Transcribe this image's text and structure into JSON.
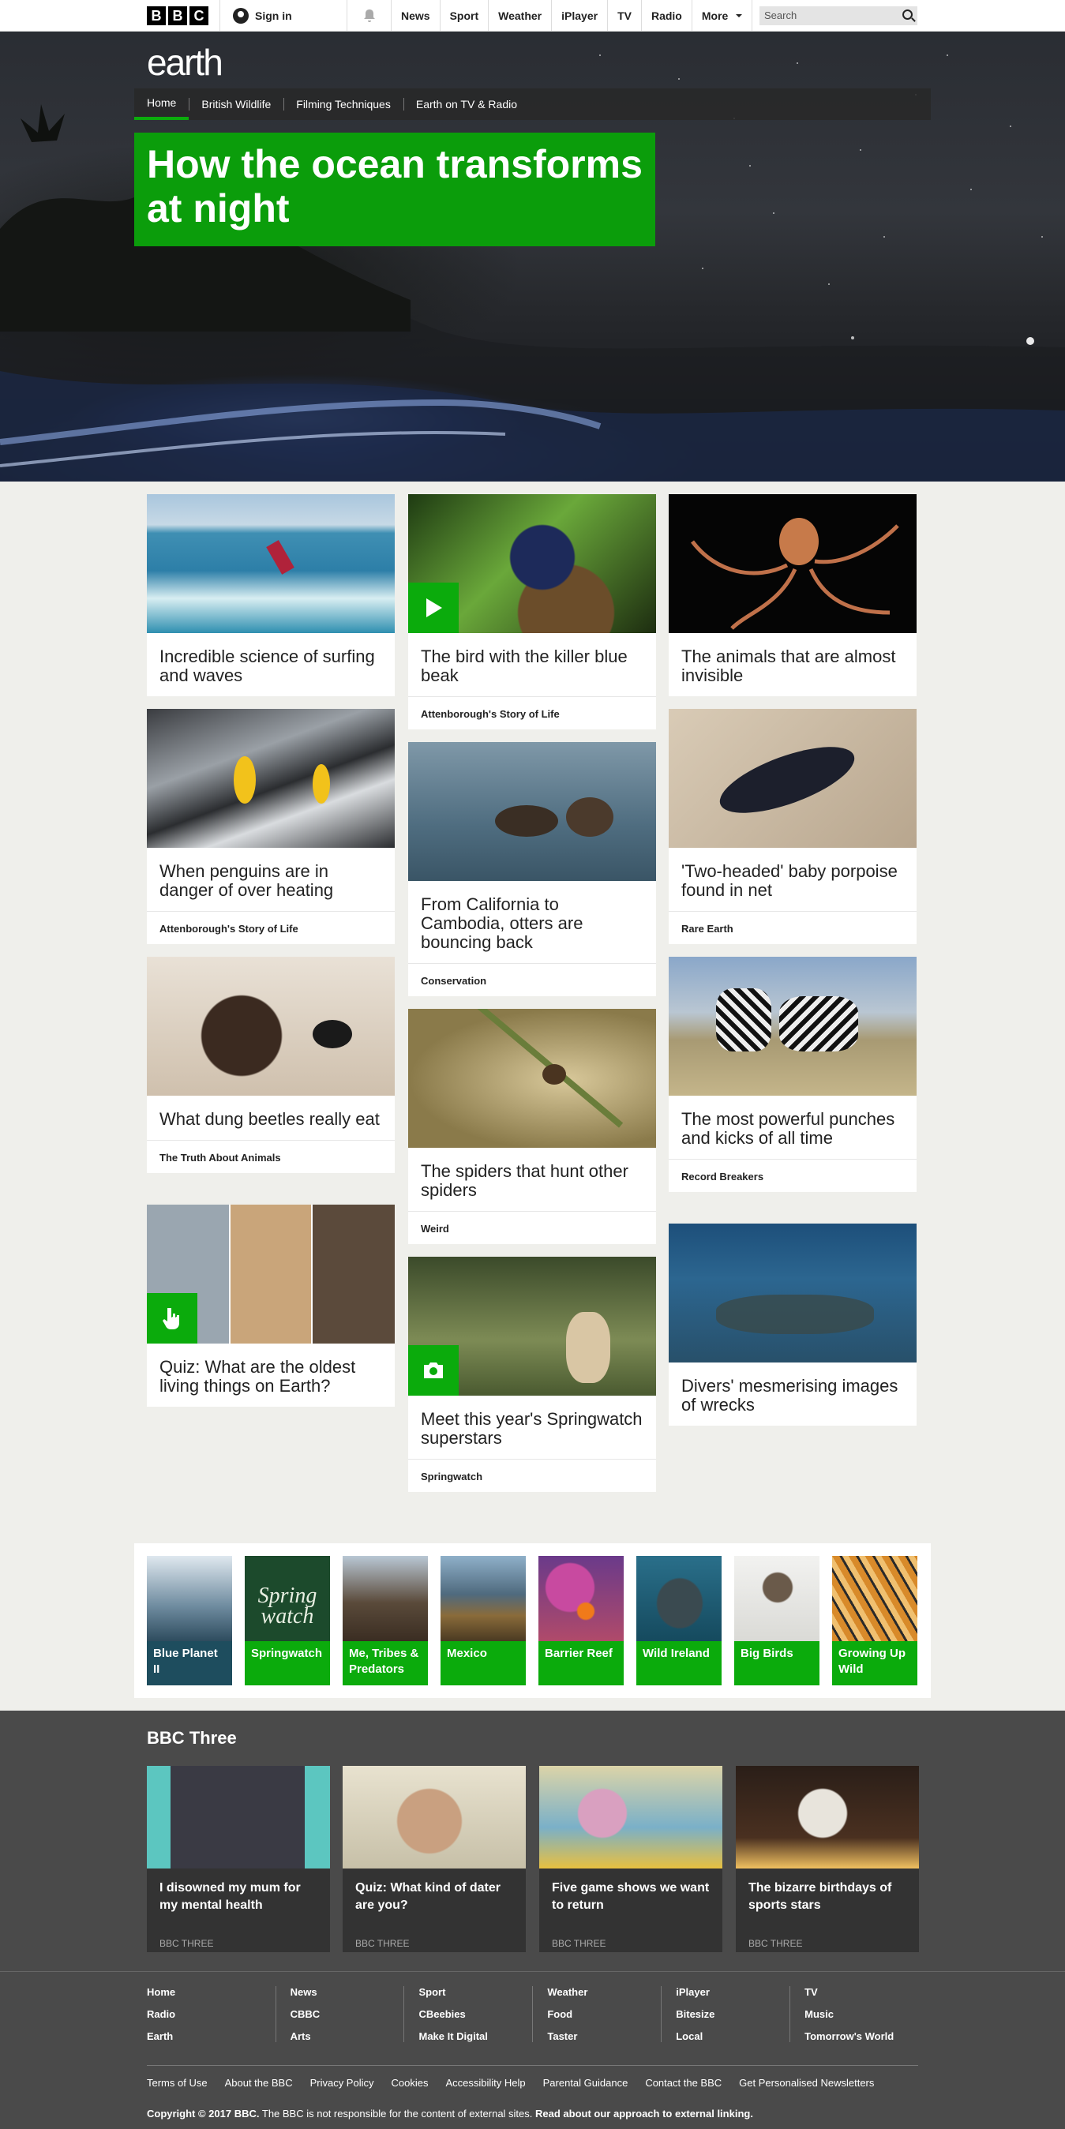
{
  "topbar": {
    "logo": [
      "B",
      "B",
      "C"
    ],
    "signin": "Sign in",
    "nav": [
      "News",
      "Sport",
      "Weather",
      "iPlayer",
      "TV",
      "Radio",
      "More"
    ],
    "search_placeholder": "Search"
  },
  "hero": {
    "brand": "earth",
    "subnav": [
      "Home",
      "British Wildlife",
      "Filming Techniques",
      "Earth on TV & Radio"
    ],
    "headline": "How the ocean transforms at night"
  },
  "cards": [
    {
      "title": "Incredible science of surfing and waves",
      "tag": ""
    },
    {
      "title": "The bird with the killer blue beak",
      "tag": "Attenborough's Story of Life"
    },
    {
      "title": "The animals that are almost invisible",
      "tag": ""
    },
    {
      "title": "When penguins are in danger of over heating",
      "tag": "Attenborough's Story of Life"
    },
    {
      "title": "From California to Cambodia, otters are bouncing back",
      "tag": "Conservation"
    },
    {
      "title": "'Two-headed' baby porpoise found in net",
      "tag": "Rare Earth"
    },
    {
      "title": "What dung beetles really eat",
      "tag": "The Truth About Animals"
    },
    {
      "title": "The spiders that hunt other spiders",
      "tag": "Weird"
    },
    {
      "title": "The most powerful punches and kicks of all time",
      "tag": "Record Breakers"
    },
    {
      "title": "Quiz: What are the oldest living things on Earth?",
      "tag": ""
    },
    {
      "title": "Meet this year's Springwatch superstars",
      "tag": "Springwatch"
    },
    {
      "title": "Divers' mesmerising images of wrecks",
      "tag": ""
    }
  ],
  "strip": [
    "Blue Planet II",
    "Springwatch",
    "Me, Tribes & Predators",
    "Mexico",
    "Barrier Reef",
    "Wild Ireland",
    "Big Birds",
    "Growing Up Wild"
  ],
  "springwatch_logo": "Spring watch",
  "three": {
    "heading": "BBC Three",
    "source": "BBC THREE",
    "items": [
      "I disowned my mum for my mental health",
      "Quiz: What kind of dater are you?",
      "Five game shows we want to return",
      "The bizarre birthdays of sports stars"
    ]
  },
  "footer": {
    "columns": [
      [
        "Home",
        "Radio",
        "Earth"
      ],
      [
        "News",
        "CBBC",
        "Arts"
      ],
      [
        "Sport",
        "CBeebies",
        "Make It Digital"
      ],
      [
        "Weather",
        "Food",
        "Taster"
      ],
      [
        "iPlayer",
        "Bitesize",
        "Local"
      ],
      [
        "TV",
        "Music",
        "Tomorrow's World"
      ]
    ],
    "legal": [
      "Terms of Use",
      "About the BBC",
      "Privacy Policy",
      "Cookies",
      "Accessibility Help",
      "Parental Guidance",
      "Contact the BBC",
      "Get Personalised Newsletters"
    ],
    "copyright_bold": "Copyright © 2017 BBC.",
    "copyright_text": " The BBC is not responsible for the content of external sites. ",
    "copyright_link": "Read about our approach to external linking."
  }
}
